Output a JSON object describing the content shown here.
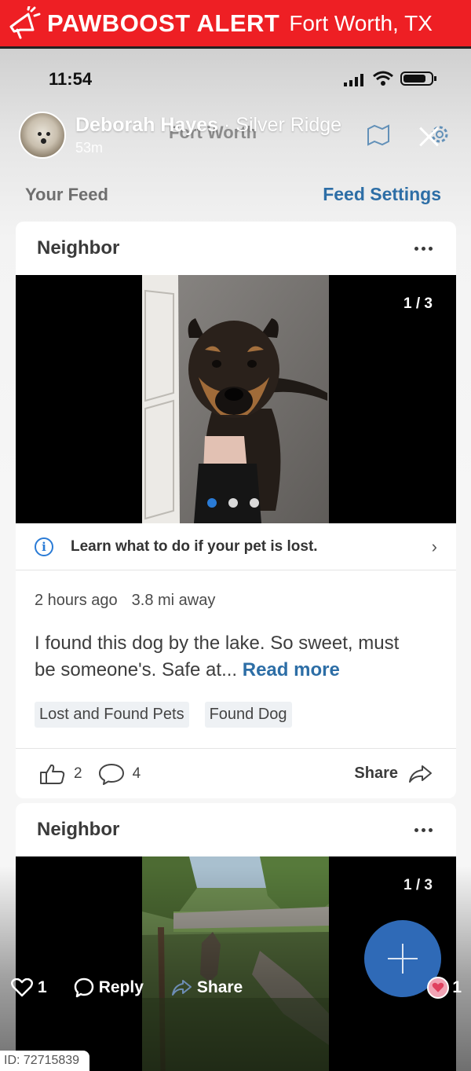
{
  "banner": {
    "brand": "PAWBOOST ALERT",
    "location": "Fort Worth, TX"
  },
  "status_bar": {
    "time": "11:54"
  },
  "story": {
    "poster_name": "Deborah Hayes",
    "group": "Silver Ridge",
    "elapsed": "53m",
    "location_under": "Fort Worth",
    "reply_label": "Reply",
    "share_label": "Share",
    "like_count": "1",
    "reaction_count": "1"
  },
  "feed": {
    "your_feed": "Your Feed",
    "feed_settings": "Feed Settings"
  },
  "post1": {
    "author": "Neighbor",
    "counter": "1 / 3",
    "lost_prompt": "Learn what to do if your pet is lost.",
    "time_ago": "2 hours ago",
    "distance": "3.8 mi away",
    "body": "I found this dog by the lake. So sweet, must be someone's. Safe at... ",
    "read_more": "Read more",
    "tags": [
      "Lost and Found Pets",
      "Found Dog"
    ],
    "likes": "2",
    "comments": "4",
    "share_label": "Share",
    "page_count": 3,
    "page_index": 0
  },
  "post2": {
    "author": "Neighbor",
    "counter": "1 / 3"
  },
  "footer": {
    "id_text": "ID: 72715839"
  },
  "colors": {
    "banner_red": "#ee1f24",
    "link_blue": "#2d6ea6",
    "fab_blue": "#2f6ab7"
  }
}
